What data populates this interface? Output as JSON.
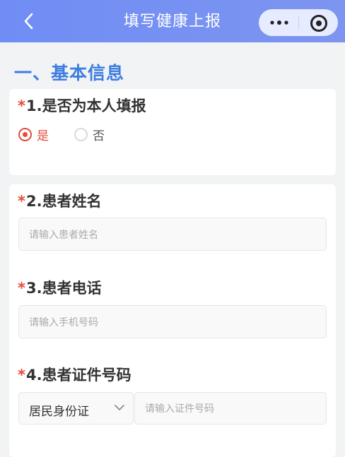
{
  "nav": {
    "title": "填写健康上报",
    "bg_color": "#7590f2"
  },
  "capsule": {
    "more_icon": "more-dots-icon",
    "close_icon": "target-close-icon"
  },
  "section": {
    "title": "一、基本信息",
    "color": "#3d7de0"
  },
  "questions": {
    "q1": {
      "star": "*",
      "label": "1.是否为本人填报",
      "options": [
        {
          "label": "是",
          "selected": true
        },
        {
          "label": "否",
          "selected": false
        }
      ]
    },
    "q2": {
      "star": "*",
      "label": "2.患者姓名",
      "placeholder": "请输入患者姓名"
    },
    "q3": {
      "star": "*",
      "label": "3.患者电话",
      "placeholder": "请输入手机号码"
    },
    "q4": {
      "star": "*",
      "label": "4.患者证件号码",
      "id_type": "居民身份证",
      "placeholder": "请输入证件号码"
    }
  },
  "colors": {
    "required": "#e34b3c",
    "selected": "#e34b3c"
  }
}
